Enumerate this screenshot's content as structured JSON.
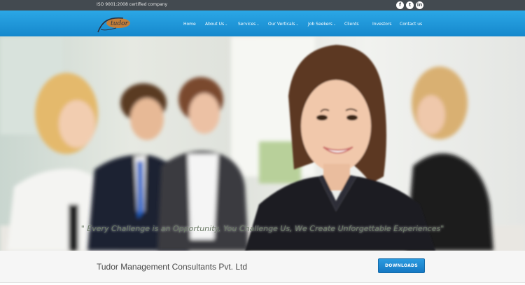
{
  "topbar": {
    "certification": "ISO 9001:2008 certified company",
    "social": [
      {
        "icon": "facebook-icon",
        "glyph": "f"
      },
      {
        "icon": "twitter-icon",
        "glyph": "t"
      },
      {
        "icon": "linkedin-icon",
        "glyph": "in"
      }
    ]
  },
  "nav": {
    "home": "Home",
    "about": "About Us",
    "services": "Services",
    "verticals": "Our Verticals",
    "jobseekers": "Job Seekers",
    "clients": "Clients",
    "investors": "Investors",
    "contact": "Contact us",
    "caret": "⌄"
  },
  "logo": {
    "text": "tudor"
  },
  "hero": {
    "tagline": "\" Every Challenge is an Opportunity, You Challenge Us, We Create Unforgettable Experiences\""
  },
  "footer_band": {
    "company": "Tudor Management Consultants Pvt. Ltd",
    "downloads_label": "DOWNLOADS"
  },
  "colors": {
    "topbar": "#434a50",
    "nav_blue": "#1e96db",
    "button_blue": "#1f86cf"
  }
}
